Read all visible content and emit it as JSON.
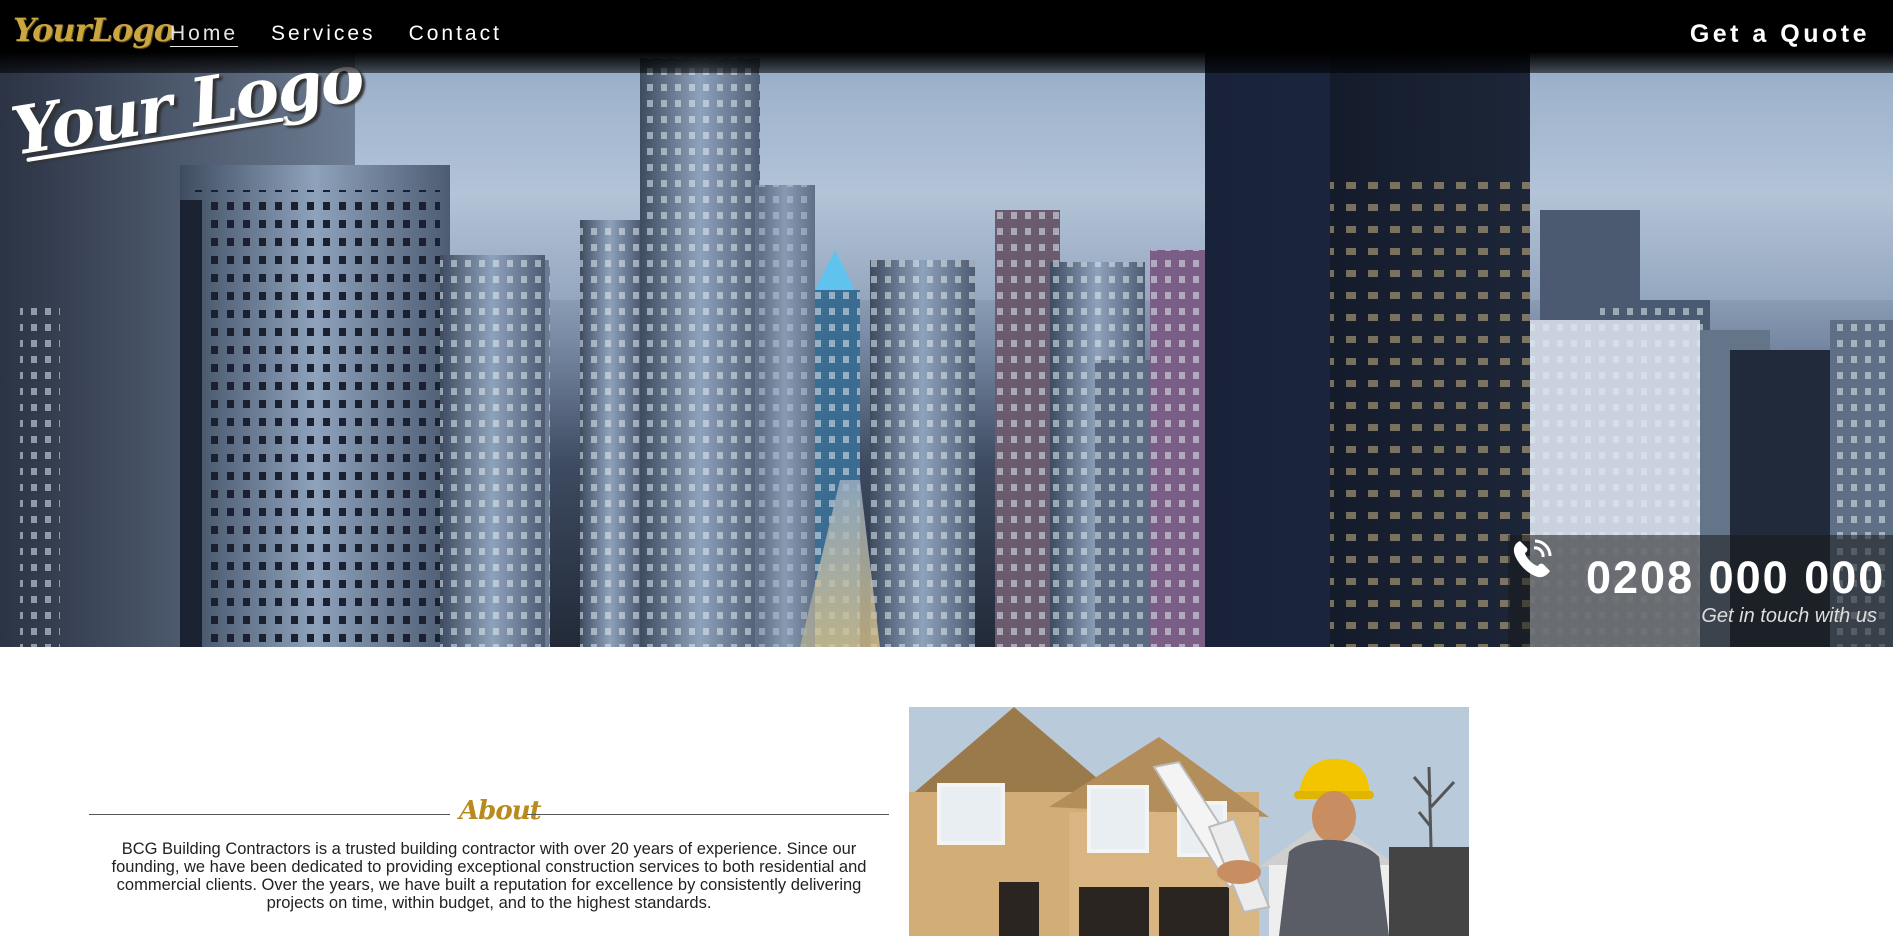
{
  "nav": {
    "logo_text": "YourLogo",
    "links": [
      "Home",
      "Services",
      "Contact"
    ],
    "active_link": "Home",
    "cta_label": "Get a Quote"
  },
  "hero": {
    "logo_text": "Your Logo",
    "phone_number": "0208 000 000",
    "phone_caption": "Get in touch with us",
    "phone_icon": "phone-icon"
  },
  "about": {
    "title": "About",
    "body": "BCG Building Contractors is a trusted building contractor with over 20 years of experience. Since our founding, we have been dedicated to providing exceptional construction services to both residential and commercial clients. Over the years, we have built a reputation for excellence by consistently delivering projects on time, within budget, and to the highest standards."
  },
  "colors": {
    "nav_background": "#000000",
    "logo_gold": "#c9a640",
    "about_title_gold": "#b98a1e",
    "text_white": "#ffffff"
  }
}
